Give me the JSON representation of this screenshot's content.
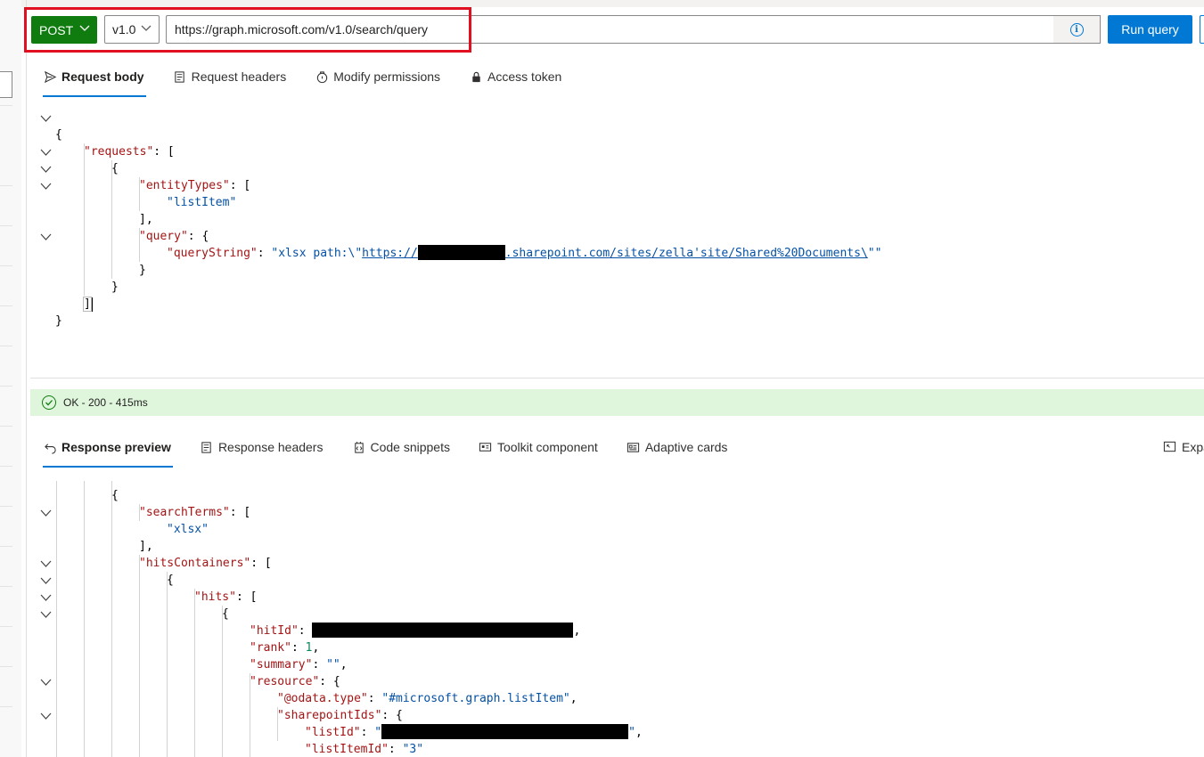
{
  "query_bar": {
    "method": "POST",
    "version": "v1.0",
    "url": "https://graph.microsoft.com/v1.0/search/query",
    "info_icon": "info-icon",
    "run_label": "Run query"
  },
  "request_tabs": [
    {
      "label": "Request body",
      "icon": "send-icon",
      "active": true
    },
    {
      "label": "Request headers",
      "icon": "document-icon",
      "active": false
    },
    {
      "label": "Modify permissions",
      "icon": "shield-icon",
      "active": false
    },
    {
      "label": "Access token",
      "icon": "lock-icon",
      "active": false
    }
  ],
  "request_body": {
    "l1": "{",
    "l2_key": "\"requests\"",
    "l2_rest": ": [",
    "l3": "{",
    "l4_key": "\"entityTypes\"",
    "l4_rest": ": [",
    "l5": "\"listItem\"",
    "l6": "],",
    "l7_key": "\"query\"",
    "l7_rest": ": {",
    "l8_key": "\"queryString\"",
    "l8_colon": ": ",
    "l8_pre": "\"xlsx path:\\\"",
    "l8_link_a": "https://",
    "l8_link_b": ".sharepoint.com/sites/zella'site/Shared%20Documents\\",
    "l8_post": "\"\"",
    "l9": "}",
    "l10": "}",
    "l11": "]",
    "l12": "}"
  },
  "status": {
    "text": "OK - 200 - 415ms",
    "icon": "checkmark-circle-icon",
    "color": "#dff6dd"
  },
  "response_tabs": [
    {
      "label": "Response preview",
      "icon": "undo-arrow-icon",
      "active": true
    },
    {
      "label": "Response headers",
      "icon": "document-icon",
      "active": false
    },
    {
      "label": "Code snippets",
      "icon": "code-snippet-icon",
      "active": false
    },
    {
      "label": "Toolkit component",
      "icon": "toolkit-icon",
      "active": false
    },
    {
      "label": "Adaptive cards",
      "icon": "card-icon",
      "active": false
    }
  ],
  "expand_label": "Expa",
  "response_body": {
    "r1_key": "\"searchTerms\"",
    "r1_rest": ": [",
    "r2": "\"xlsx\"",
    "r3": "],",
    "r4_key": "\"hitsContainers\"",
    "r4_rest": ": [",
    "r5": "{",
    "r6_key": "\"hits\"",
    "r6_rest": ": [",
    "r7": "{",
    "r8_key": "\"hitId\"",
    "r8_rest": ": ",
    "r8_end": ",",
    "r9_key": "\"rank\"",
    "r9_colon": ": ",
    "r9_val": "1",
    "r9_end": ",",
    "r10_key": "\"summary\"",
    "r10_colon": ": ",
    "r10_val": "\"\"",
    "r10_end": ",",
    "r11_key": "\"resource\"",
    "r11_rest": ": {",
    "r12_key": "\"@odata.type\"",
    "r12_colon": ": ",
    "r12_val": "\"#microsoft.graph.listItem\"",
    "r12_end": ",",
    "r13_key": "\"sharepointIds\"",
    "r13_rest": ": {",
    "r14_key": "\"listId\"",
    "r14_colon": ": ",
    "r14_val_a": "\"",
    "r14_val_b": "\"",
    "r14_end": ",",
    "r15_key": "\"listItemId\"",
    "r15_colon": ": ",
    "r15_val": "\"3\"",
    "r16": "},"
  }
}
